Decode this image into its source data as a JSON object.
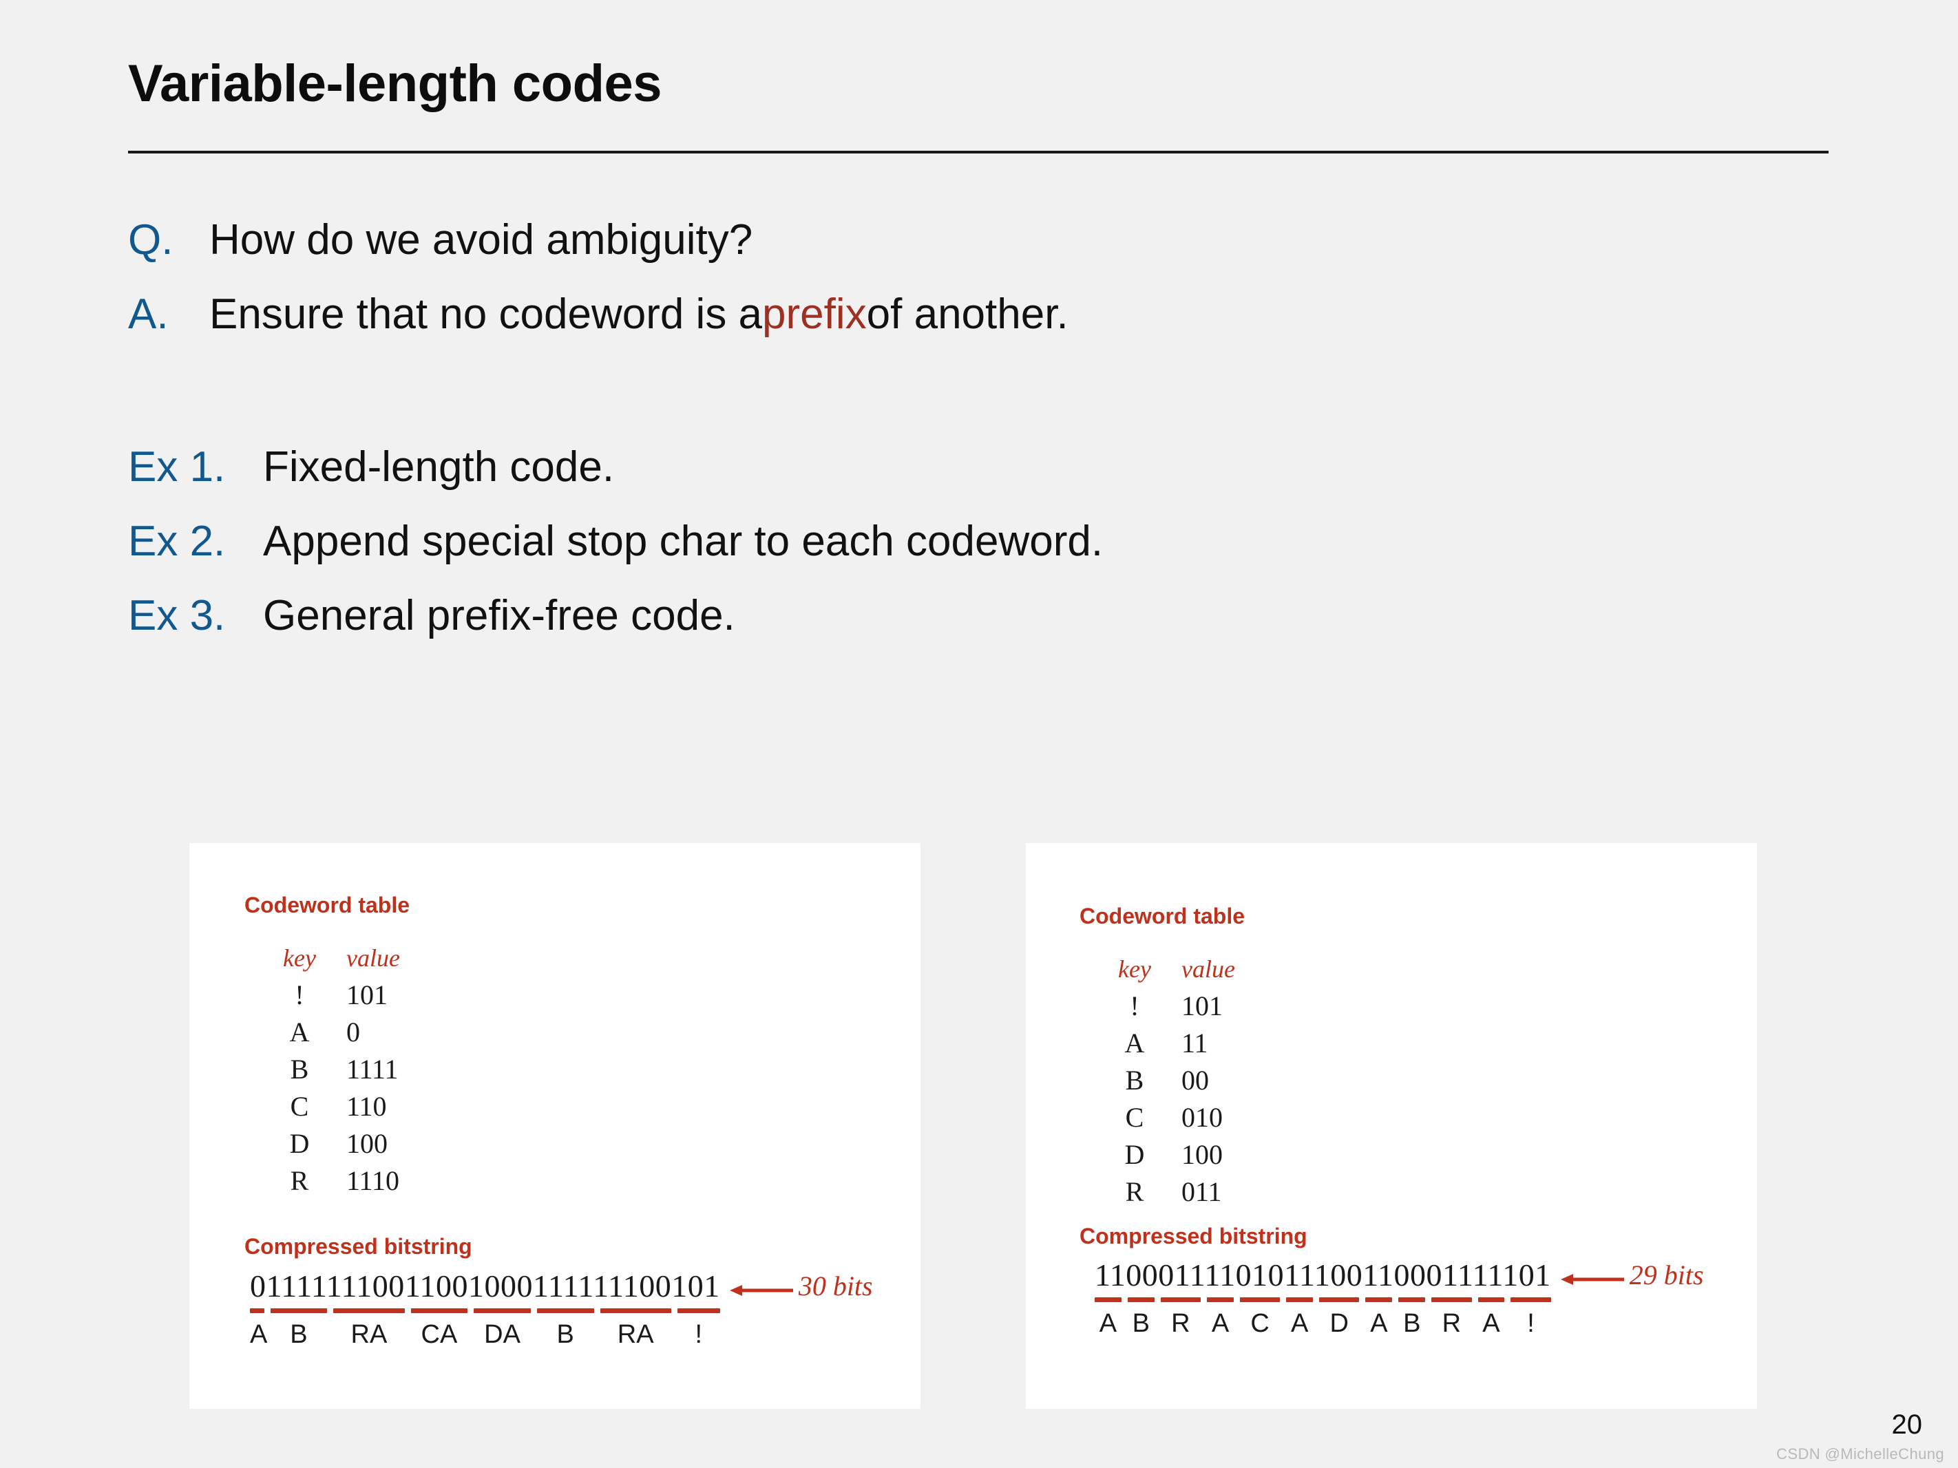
{
  "slide": {
    "title": "Variable-length codes",
    "page_number": "20",
    "watermark": "CSDN @MichelleChung",
    "colors": {
      "background": "#f1f1f1",
      "accent_blue": "#11588f",
      "accent_red": "#9c3123",
      "panel_red": "#c0311c",
      "panel_background": "#ffffff",
      "text": "#111111"
    }
  },
  "qa": [
    {
      "tag": "Q.",
      "text_before": "How do we avoid ambiguity?",
      "highlight": "",
      "text_after": ""
    },
    {
      "tag": "A.",
      "text_before": "Ensure that no codeword is a ",
      "highlight": "prefix",
      "text_after": " of another."
    }
  ],
  "examples": [
    {
      "tag": "Ex 1.",
      "text": "Fixed-length code."
    },
    {
      "tag": "Ex 2.",
      "text": "Append special stop char to each codeword."
    },
    {
      "tag": "Ex 3.",
      "text": "General prefix-free code."
    }
  ],
  "panels": [
    {
      "id": "left",
      "table_label": "Codeword table",
      "columns": {
        "key": "key",
        "value": "value"
      },
      "rows": [
        {
          "key": "!",
          "value": "101"
        },
        {
          "key": "A",
          "value": "0"
        },
        {
          "key": "B",
          "value": "1111"
        },
        {
          "key": "C",
          "value": "110"
        },
        {
          "key": "D",
          "value": "100"
        },
        {
          "key": "R",
          "value": "1110"
        }
      ],
      "bitstring_label": "Compressed bitstring",
      "bitstring": "011111110011001000111111100101",
      "bit_count_note": "30 bits",
      "segments": [
        {
          "label": "A",
          "bits": "0"
        },
        {
          "label": "B",
          "bits": "1111"
        },
        {
          "label": "RA",
          "bits": "11100"
        },
        {
          "label": "CA",
          "bits": "1100"
        },
        {
          "label": "DA",
          "bits": "1000"
        },
        {
          "label": "B",
          "bits": "1111"
        },
        {
          "label": "RA",
          "bits": "11100"
        },
        {
          "label": "!",
          "bits": "101"
        }
      ]
    },
    {
      "id": "right",
      "table_label": "Codeword table",
      "columns": {
        "key": "key",
        "value": "value"
      },
      "rows": [
        {
          "key": "!",
          "value": "101"
        },
        {
          "key": "A",
          "value": "11"
        },
        {
          "key": "B",
          "value": "00"
        },
        {
          "key": "C",
          "value": "010"
        },
        {
          "key": "D",
          "value": "100"
        },
        {
          "key": "R",
          "value": "011"
        }
      ],
      "bitstring_label": "Compressed bitstring",
      "bitstring": "11000111101011100110001111101",
      "bit_count_note": "29 bits",
      "segments": [
        {
          "label": "A",
          "bits": "11"
        },
        {
          "label": "B",
          "bits": "00"
        },
        {
          "label": "R",
          "bits": "011"
        },
        {
          "label": "A",
          "bits": "11"
        },
        {
          "label": "C",
          "bits": "010"
        },
        {
          "label": "A",
          "bits": "11"
        },
        {
          "label": "D",
          "bits": "100"
        },
        {
          "label": "A",
          "bits": "11"
        },
        {
          "label": "B",
          "bits": "00"
        },
        {
          "label": "R",
          "bits": "011"
        },
        {
          "label": "A",
          "bits": "11"
        },
        {
          "label": "!",
          "bits": "101"
        }
      ]
    }
  ]
}
